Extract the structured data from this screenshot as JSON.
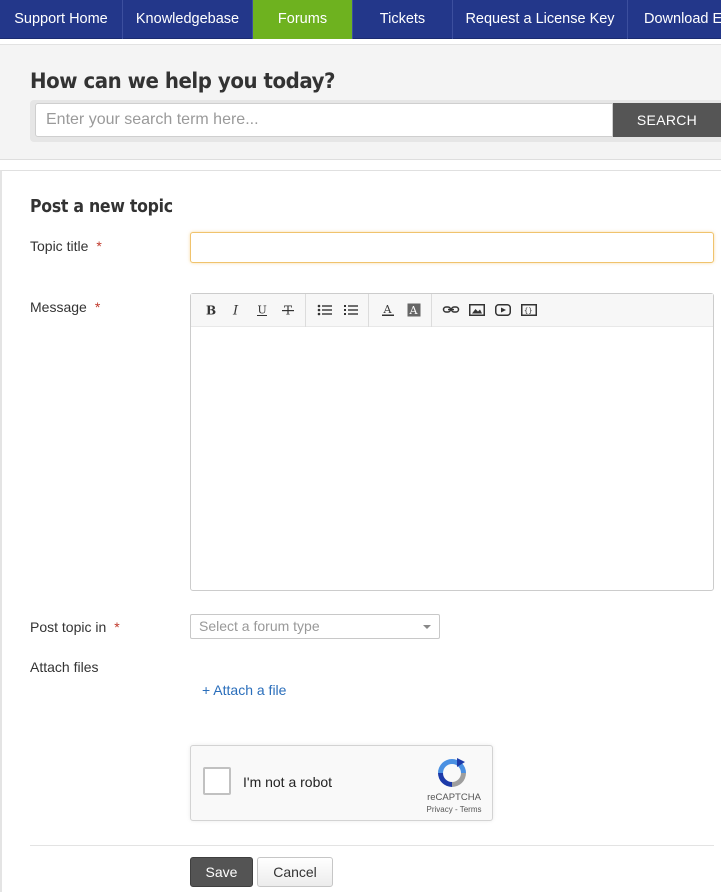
{
  "nav": {
    "items": [
      {
        "label": "Support Home",
        "active": false
      },
      {
        "label": "Knowledgebase",
        "active": false
      },
      {
        "label": "Forums",
        "active": true
      },
      {
        "label": "Tickets",
        "active": false
      },
      {
        "label": "Request a License Key",
        "active": false
      },
      {
        "label": "Download E",
        "active": false
      }
    ]
  },
  "search": {
    "heading": "How can we help you today?",
    "placeholder": "Enter your search term here...",
    "button_label": "SEARCH"
  },
  "form": {
    "title": "Post a new topic",
    "required_marker": "*",
    "topic_title_label": "Topic title",
    "message_label": "Message",
    "post_in_label": "Post topic in",
    "forum_select_placeholder": "Select a forum type",
    "attach_label": "Attach files",
    "attach_link": "+ Attach a file",
    "toolbar_icons": [
      "bold-icon",
      "italic-icon",
      "underline-icon",
      "strikethrough-icon",
      "bulleted-list-icon",
      "numbered-list-icon",
      "text-color-icon",
      "background-color-icon",
      "link-icon",
      "image-icon",
      "video-icon",
      "code-icon"
    ],
    "save_label": "Save",
    "cancel_label": "Cancel"
  },
  "captcha": {
    "label": "I'm not a robot",
    "brand": "reCAPTCHA",
    "terms": "Privacy - Terms"
  },
  "colors": {
    "nav_bg": "#23378a",
    "nav_active": "#6eb21f",
    "search_button": "#555555",
    "required": "#c0392b",
    "link": "#2a6ebb"
  }
}
